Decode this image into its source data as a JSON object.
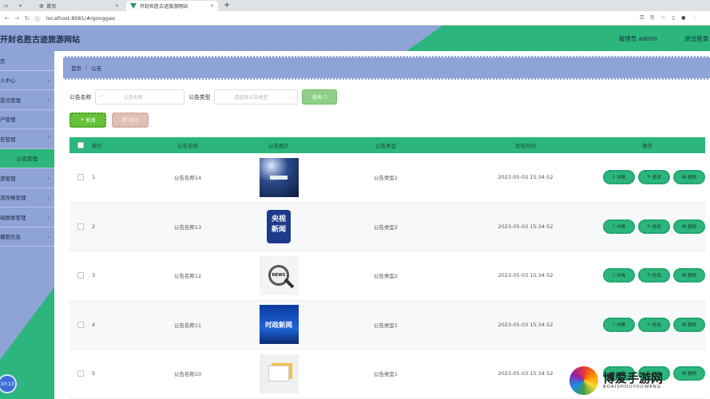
{
  "browser": {
    "tab1": "首页",
    "tab2": "开封名胜古迹旅游网站",
    "url": "localhost:8081/#/gonggao"
  },
  "header": {
    "title": "开封名胜古迹旅游网站",
    "user": "管理员 admin",
    "logout": "退出登录"
  },
  "sidebar": {
    "items": [
      {
        "label": "页"
      },
      {
        "label": "人中心"
      },
      {
        "label": "景点管理"
      },
      {
        "label": "户管理"
      },
      {
        "label": "告管理"
      },
      {
        "label": "公告管理"
      },
      {
        "label": "游管理"
      },
      {
        "label": "游攻略管理"
      },
      {
        "label": "础数据管理"
      },
      {
        "label": "播图信息"
      }
    ],
    "clock": "10:13"
  },
  "breadcrumb": {
    "home": "首页",
    "current": "公告"
  },
  "search": {
    "name_label": "公告名称",
    "name_placeholder": "公告名称",
    "type_label": "公告类型",
    "type_placeholder": "请选择公告类型",
    "query_button": "查询"
  },
  "actions": {
    "add": "新增",
    "delete": "删除"
  },
  "table": {
    "headers": [
      "索引",
      "公告名称",
      "公告图片",
      "公告类型",
      "发布时间",
      "操作"
    ],
    "op_labels": {
      "detail": "详情",
      "edit": "修改",
      "delete": "删除"
    },
    "rows": [
      {
        "index": "1",
        "name": "公告名称14",
        "type": "公告类型1",
        "time": "2023-05-03 15:34:52",
        "image": "stage"
      },
      {
        "index": "2",
        "name": "公告名称13",
        "type": "公告类型2",
        "time": "2023-05-03 15:34:52",
        "image": "cctv",
        "image_text": "央视\n新闻"
      },
      {
        "index": "3",
        "name": "公告名称12",
        "type": "公告类型2",
        "time": "2023-05-03 15:34:52",
        "image": "magnifier",
        "image_text": "NEWS"
      },
      {
        "index": "4",
        "name": "公告名称11",
        "type": "公告类型1",
        "time": "2023-05-03 15:34:52",
        "image": "politics",
        "image_text": "时政新闻"
      },
      {
        "index": "5",
        "name": "公告名称10",
        "type": "公告类型1",
        "time": "2023-05-03 15:34:52",
        "image": "papers"
      }
    ]
  },
  "watermark": {
    "text": "博爱手游网",
    "sub": "BOAISHOUYOUWANG"
  },
  "colors": {
    "accent": "#2cb57c",
    "nav": "#8ea3d6"
  }
}
